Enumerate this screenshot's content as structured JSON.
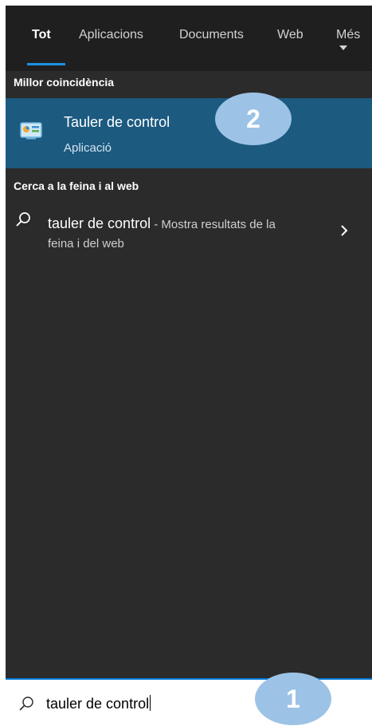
{
  "tabs": [
    {
      "label": "Tot",
      "active": true
    },
    {
      "label": "Aplicacions",
      "active": false
    },
    {
      "label": "Documents",
      "active": false
    },
    {
      "label": "Web",
      "active": false
    },
    {
      "label": "Més",
      "active": false
    }
  ],
  "best_match": {
    "header": "Millor coincidència",
    "title": "Tauler de control",
    "subtitle": "Aplicació",
    "icon": "control-panel-icon"
  },
  "web_section": {
    "header": "Cerca a la feina i al web",
    "query": "tauler de control",
    "description_line1": " - Mostra resultats de la",
    "description_line2": "feina i del web",
    "icon": "search-icon"
  },
  "search": {
    "value": "tauler de control",
    "icon": "search-icon"
  },
  "annotations": {
    "step1": "1",
    "step2": "2",
    "color": "#9cc3e6"
  },
  "colors": {
    "panel": "#2b2b2b",
    "tabbar": "#1f1f1f",
    "selected": "#1c5a80",
    "accent": "#1a8fe3"
  }
}
